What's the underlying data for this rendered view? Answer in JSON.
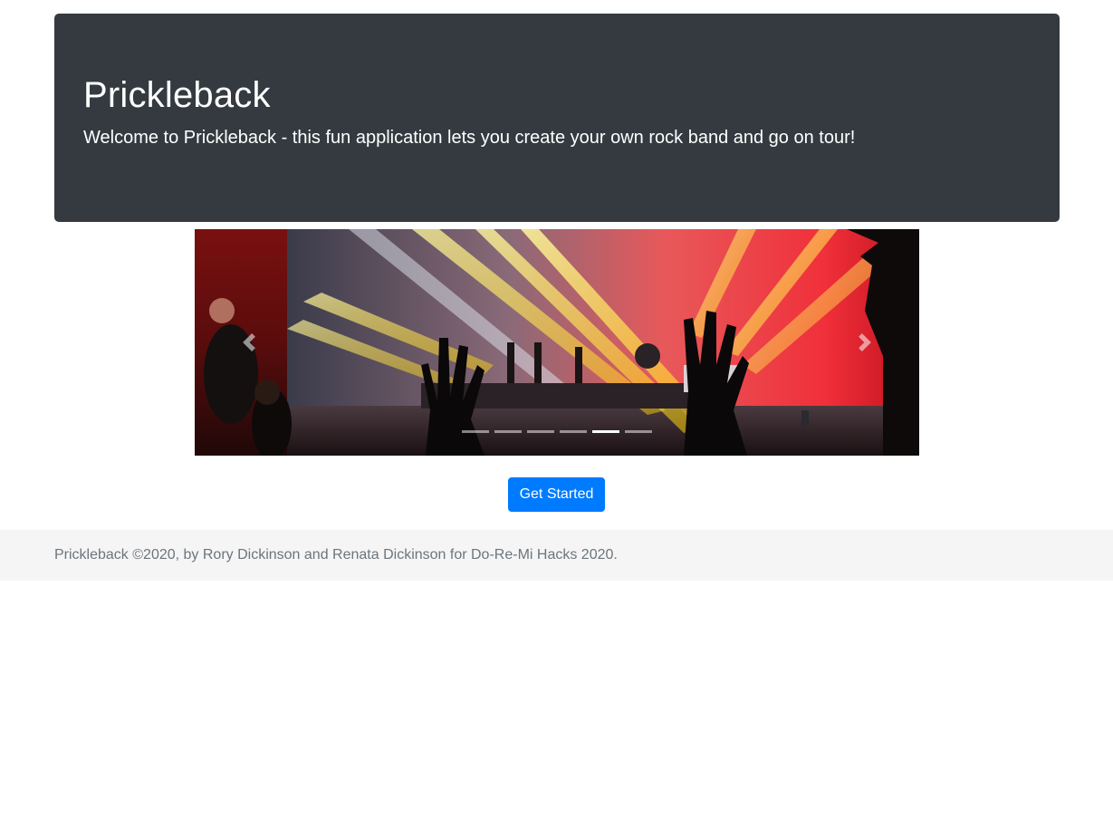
{
  "jumbotron": {
    "title": "Prickleback",
    "lead": "Welcome to Prickleback - this fun application lets you create your own rock band and go on tour!"
  },
  "carousel": {
    "slide_count": 6,
    "active_index": 4,
    "prev_icon": "chevron-left-icon",
    "next_icon": "chevron-right-icon"
  },
  "actions": {
    "get_started_label": "Get Started"
  },
  "footer": {
    "text": "Prickleback ©2020, by Rory Dickinson and Renata Dickinson for Do-Re-Mi Hacks 2020."
  },
  "colors": {
    "jumbotron_bg": "#343a40",
    "primary": "#007bff",
    "footer_bg": "#f5f5f5",
    "footer_text": "#6c757d"
  }
}
